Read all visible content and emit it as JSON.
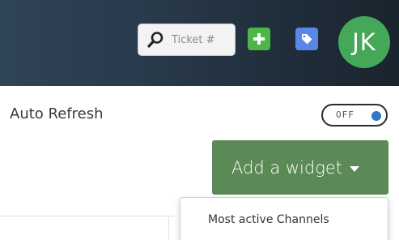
{
  "header": {
    "search": {
      "placeholder": "Ticket #",
      "icon": "search-icon"
    },
    "add_button": {
      "icon": "plus-icon",
      "color": "#4cb748"
    },
    "tag_button": {
      "icon": "tag-icon",
      "color": "#5a86e8"
    },
    "avatar": {
      "initials": "JK",
      "color": "#44a858"
    }
  },
  "auto_refresh": {
    "label": "Auto Refresh",
    "toggle_text": "OFF",
    "state": "off",
    "knob_color": "#2e77c9"
  },
  "widget": {
    "button_label": "Add a widget",
    "button_color": "#5b8a56",
    "caret_icon": "caret-down-icon",
    "menu_items": [
      "Most active Channels"
    ]
  }
}
